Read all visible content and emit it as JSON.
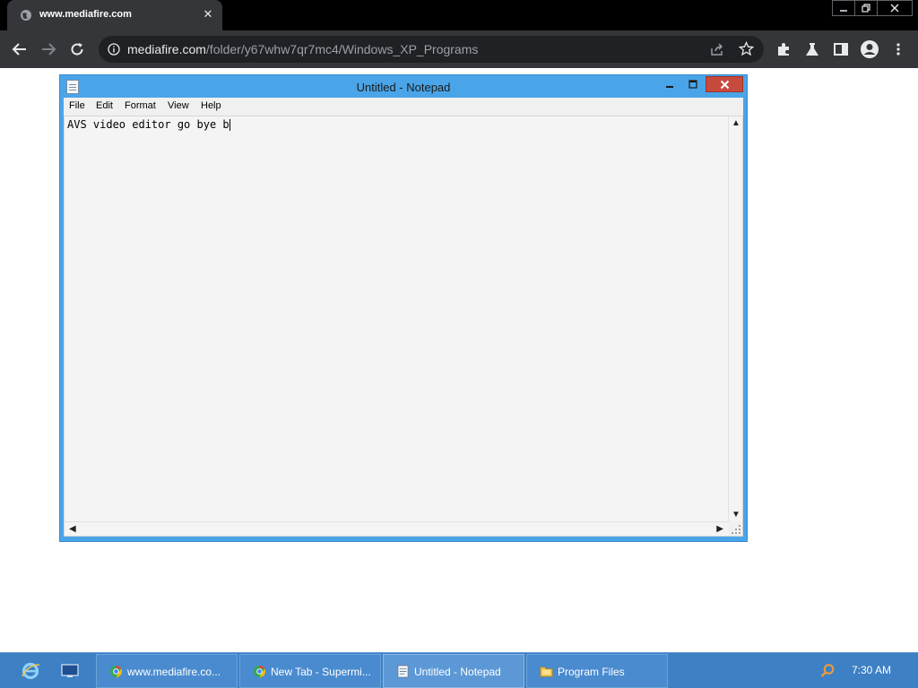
{
  "browser": {
    "tab": {
      "title": "www.mediafire.com",
      "favicon": "globe-icon"
    },
    "omnibox": {
      "domain": "mediafire.com",
      "path": "/folder/y67whw7qr7mc4/Windows_XP_Programs"
    },
    "toolbar_icons": [
      "back-icon",
      "forward-icon",
      "reload-icon",
      "info-icon",
      "share-icon",
      "star-icon",
      "extensions-icon",
      "labs-icon",
      "sidepanel-icon",
      "profile-icon",
      "menu-icon"
    ]
  },
  "notepad": {
    "title": "Untitled - Notepad",
    "menu": [
      "File",
      "Edit",
      "Format",
      "View",
      "Help"
    ],
    "text": "AVS video editor go bye b"
  },
  "taskbar": {
    "pinned": [
      "ie-icon",
      "show-desktop-icon"
    ],
    "tasks": [
      {
        "label": "www.mediafire.co...",
        "icon": "chrome-icon"
      },
      {
        "label": "New Tab - Supermi...",
        "icon": "chrome-icon"
      },
      {
        "label": "Untitled - Notepad",
        "icon": "notepad-icon"
      },
      {
        "label": "Program Files",
        "icon": "folder-icon"
      }
    ],
    "clock": "7:30 AM"
  },
  "colors": {
    "chrome_dark": "#35363a",
    "titlebar_black": "#000000",
    "notepad_frame": "#4aa4e8",
    "close_red": "#c74a3e",
    "taskbar_blue": "#3d80c4"
  }
}
